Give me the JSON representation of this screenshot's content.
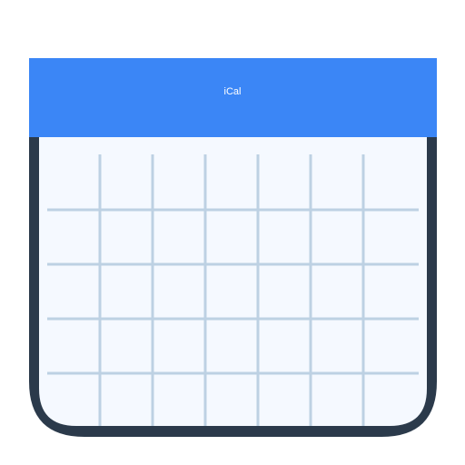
{
  "app": {
    "title": "iCal"
  },
  "icon": {
    "name": "calendar-icon",
    "colors": {
      "header": "#3b86f6",
      "frame": "#2b3a4b",
      "body": "#f5f9ff",
      "grid": "#bdd1e3",
      "title_text": "#ffffff",
      "background": "#ffffff"
    },
    "grid": {
      "columns": 7,
      "rows": 5
    }
  }
}
